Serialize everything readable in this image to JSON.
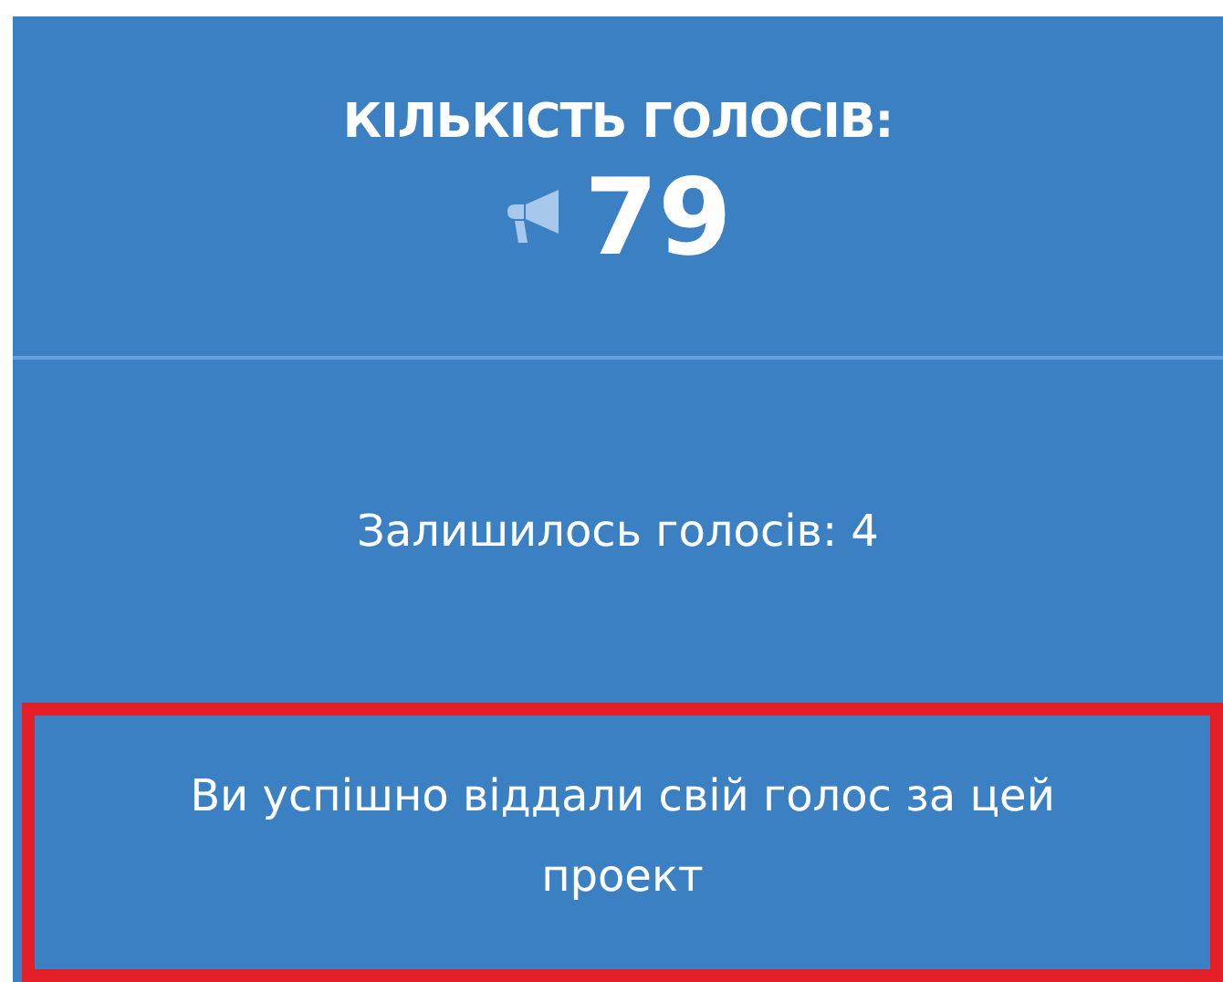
{
  "votes": {
    "title": "КІЛЬКІСТЬ ГОЛОСІВ:",
    "count": "79"
  },
  "remaining": {
    "text": "Залишилось голосів: 4"
  },
  "message": {
    "text": "Ви успішно віддали свій голос за цей проект",
    "highlighted": true
  }
}
